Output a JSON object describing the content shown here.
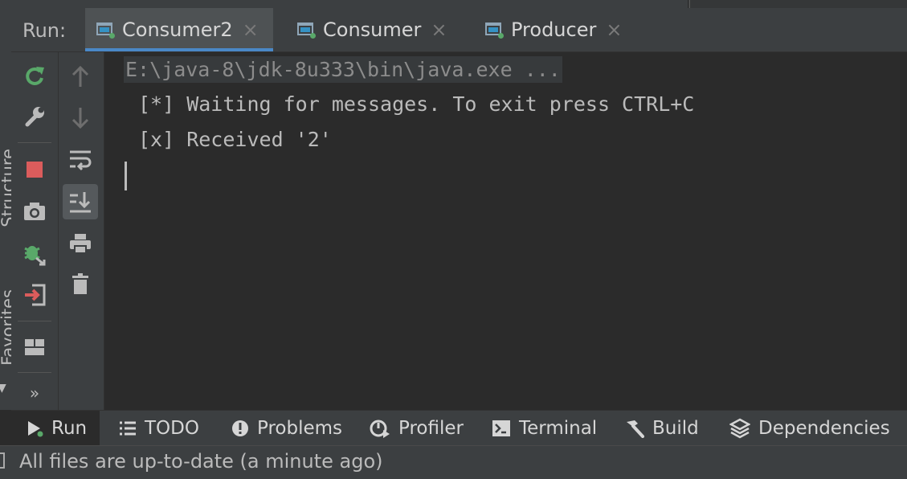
{
  "run_panel": {
    "label": "Run:",
    "tabs": [
      {
        "label": "Consumer2",
        "close": "×",
        "active": true
      },
      {
        "label": "Consumer",
        "close": "×",
        "active": false
      },
      {
        "label": "Producer",
        "close": "×",
        "active": false
      }
    ]
  },
  "side_strip": {
    "structure_label": "Structure",
    "favorites_label": "Favorites"
  },
  "console": {
    "command_line": "E:\\java-8\\jdk-8u333\\bin\\java.exe ...",
    "lines": [
      "[*] Waiting for messages. To exit press CTRL+C",
      "[x] Received '2'"
    ]
  },
  "toolbar_primary": {
    "icons": [
      "rerun-icon",
      "settings-wrench-icon",
      "stop-icon",
      "camera-icon",
      "debug-attach-icon",
      "exit-icon",
      "layout-icon"
    ],
    "more": "»"
  },
  "toolbar_secondary": {
    "icons": [
      "up-arrow-icon",
      "down-arrow-icon",
      "soft-wrap-icon",
      "scroll-to-end-icon",
      "print-icon",
      "trash-icon"
    ]
  },
  "bottom_tools": [
    {
      "label": "Run",
      "icon": "play-icon",
      "active": true
    },
    {
      "label": "TODO",
      "icon": "list-icon"
    },
    {
      "label": "Problems",
      "icon": "problems-icon"
    },
    {
      "label": "Profiler",
      "icon": "profiler-icon"
    },
    {
      "label": "Terminal",
      "icon": "terminal-icon"
    },
    {
      "label": "Build",
      "icon": "hammer-icon"
    },
    {
      "label": "Dependencies",
      "icon": "layers-icon"
    }
  ],
  "status_bar": {
    "text": "All files are up-to-date (a minute ago)"
  },
  "colors": {
    "accent": "#4a88c7",
    "rerun_green": "#59a869",
    "stop_red": "#db5c5c",
    "console_bg": "#2b2b2b",
    "panel_bg": "#3c3f41"
  }
}
